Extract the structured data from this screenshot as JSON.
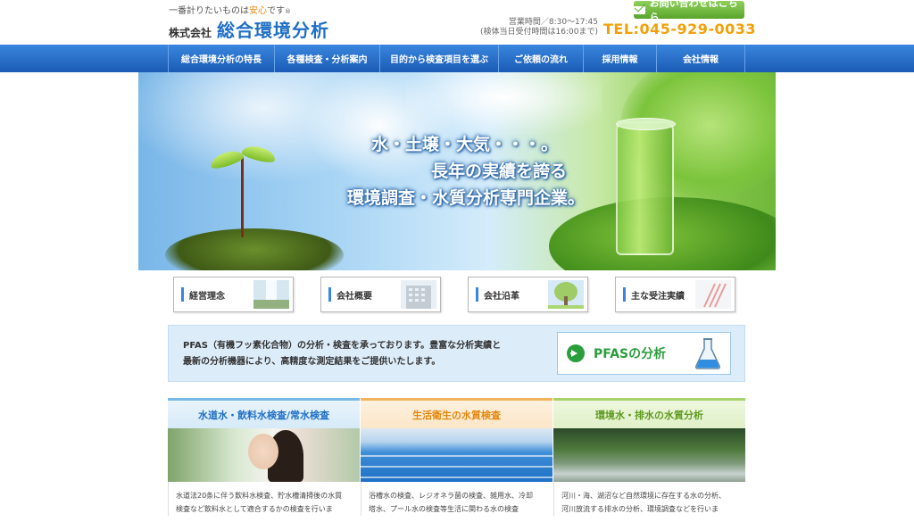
{
  "header": {
    "tagline_pre": "一番計りたいものは",
    "tagline_hl": "安心",
    "tagline_post": "です",
    "tagline_mark": "®",
    "company_prefix": "株式会社",
    "company_name": "総合環境分析",
    "hours_line1": "営業時間／8:30〜17:45",
    "hours_line2": "(検体当日受付時間は16:00まで)",
    "contact_label": "お問い合わせはこちら",
    "tel": "TEL:045-929-0033"
  },
  "nav": {
    "items": [
      {
        "label": "総合環境分析の特長"
      },
      {
        "label": "各種検査・分析案内"
      },
      {
        "label": "目的から検査項目を選ぶ"
      },
      {
        "label": "ご依頼の流れ"
      },
      {
        "label": "採用情報"
      },
      {
        "label": "会社情報"
      }
    ]
  },
  "hero": {
    "line1": "水・土壌・大気・・・。",
    "line2": "長年の実績を誇る",
    "line3": "環境調査・水質分析専門企業。"
  },
  "info_buttons": [
    {
      "label": "経営理念",
      "icon": "waterfall-thumb"
    },
    {
      "label": "会社概要",
      "icon": "building-thumb"
    },
    {
      "label": "会社沿革",
      "icon": "tree-thumb"
    },
    {
      "label": "主な受注実績",
      "icon": "lab-thumb"
    }
  ],
  "pfas": {
    "text_line1": "PFAS（有機フッ素化合物）の分析・検査を承っております。豊富な分析実績と",
    "text_line2": "最新の分析機器により、高精度な測定結果をご提供いたします。",
    "button_label": "PFASの分析"
  },
  "services": [
    {
      "title": "水道水・飲料水検査/常水検査",
      "desc_line1": "水道法20条に伴う飲料水検査、貯水槽清掃後の水質",
      "desc_line2": "検査など飲料水として適合するかの検査を行いま"
    },
    {
      "title": "生活衛生の水質検査",
      "desc_line1": "浴槽水の検査、レジオネラ菌の検査、雑用水、冷却",
      "desc_line2": "塔水、プール水の検査等生活に関わる水の検査"
    },
    {
      "title": "環境水・排水の水質分析",
      "desc_line1": "河川・海、湖沼など自然環境に存在する水の分析、",
      "desc_line2": "河川放流する排水の分析、環境調査などを行いま"
    }
  ],
  "colors": {
    "nav_blue": "#1f6fc6",
    "tel_orange": "#f2a007",
    "contact_green": "#5aa52c",
    "pfas_green": "#2a9d3c"
  }
}
